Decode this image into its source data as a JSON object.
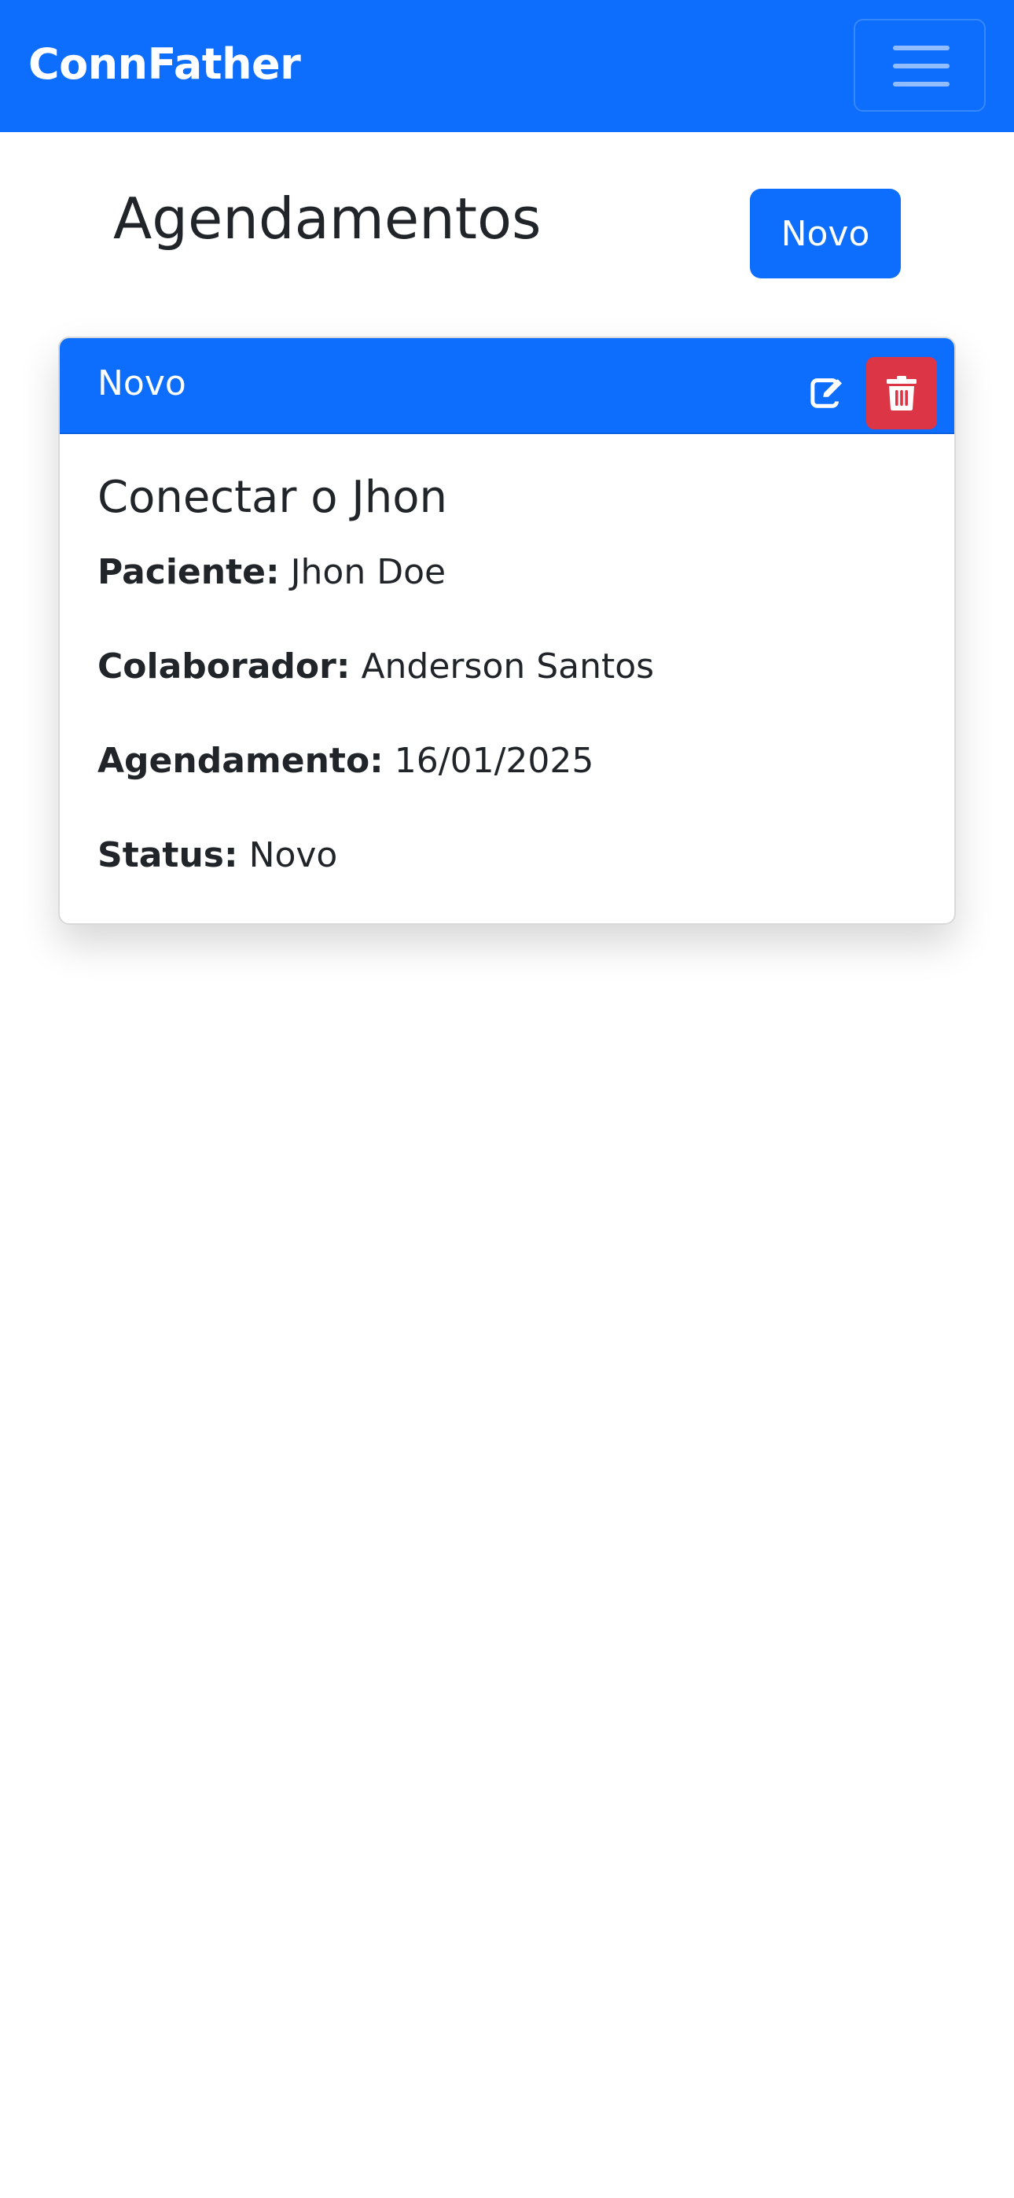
{
  "navbar": {
    "brand": "ConnFather",
    "toggler_icon": "hamburger-menu-icon"
  },
  "main": {
    "title": "Agendamentos",
    "new_button_label": "Novo"
  },
  "card": {
    "header_status": "Novo",
    "edit_icon": "edit-icon",
    "delete_icon": "trash-icon",
    "title": "Conectar o Jhon",
    "fields": [
      {
        "label": "Paciente:",
        "value": "Jhon Doe"
      },
      {
        "label": "Colaborador:",
        "value": "Anderson Santos"
      },
      {
        "label": "Agendamento:",
        "value": "16/01/2025"
      },
      {
        "label": "Status:",
        "value": "Novo"
      }
    ]
  },
  "colors": {
    "primary": "#0d6efd",
    "danger": "#dc3545",
    "text": "#212529"
  }
}
